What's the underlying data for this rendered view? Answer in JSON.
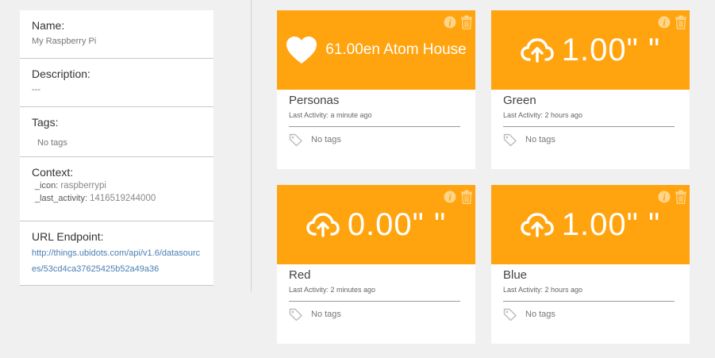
{
  "info": {
    "name_label": "Name:",
    "name_value": "My Raspberry Pi",
    "description_label": "Description:",
    "description_value": "---",
    "tags_label": "Tags:",
    "tags_value": "No tags",
    "context_label": "Context:",
    "context": [
      {
        "key": "_icon:",
        "value": "raspberrypi"
      },
      {
        "key": "_last_activity:",
        "value": "1416519244000"
      }
    ],
    "url_label": "URL Endpoint:",
    "url_value": "http://things.ubidots.com/api/v1.6/datasources/53cd4ca37625425b52a49a36"
  },
  "colors": {
    "accent": "#ffa40f"
  },
  "cards": [
    {
      "icon": "heart-icon",
      "value": "61.00en Atom House",
      "title": "Personas",
      "activity": "Last Activity: a minute ago",
      "tags": "No tags"
    },
    {
      "icon": "cloud-upload-icon",
      "value": "1.00\" \"",
      "title": "Green",
      "activity": "Last Activity: 2 hours ago",
      "tags": "No tags"
    },
    {
      "icon": "cloud-upload-icon",
      "value": "0.00\" \"",
      "title": "Red",
      "activity": "Last Activity: 2 minutes ago",
      "tags": "No tags"
    },
    {
      "icon": "cloud-upload-icon",
      "value": "1.00\" \"",
      "title": "Blue",
      "activity": "Last Activity: 2 hours ago",
      "tags": "No tags"
    }
  ]
}
